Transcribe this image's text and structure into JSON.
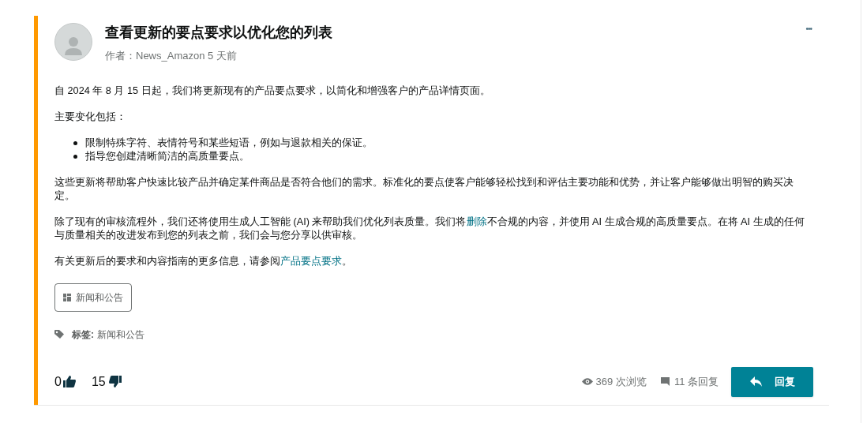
{
  "post": {
    "title": "查看更新的要点要求以优化您的列表",
    "byline": "作者：News_Amazon 5 天前",
    "menu": "•••",
    "paragraphs": [
      {
        "kind": "text",
        "segments": [
          {
            "text": "自 2024 年 8 月 15 日起，我们将更新现有的产品要点要求，以简化和增强客户的产品详情页面。",
            "kind": "plain"
          }
        ]
      },
      {
        "kind": "text",
        "segments": [
          {
            "text": "主要变化包括：",
            "kind": "plain"
          }
        ]
      },
      {
        "kind": "list",
        "items": [
          "限制特殊字符、表情符号和某些短语，例如与退款相关的保证。",
          "指导您创建清晰简洁的高质量要点。"
        ]
      },
      {
        "kind": "text",
        "segments": [
          {
            "text": "这些更新将帮助客户快速比较产品并确定某件商品是否符合他们的需求。标准化的要点使客户能够轻松找到和评估主要功能和优势，并让客户能够做出明智的购买决定。",
            "kind": "plain"
          }
        ]
      },
      {
        "kind": "text",
        "segments": [
          {
            "text": "除了现有的审核流程外，我们还将使用生成人工智能 (AI) 来帮助我们优化列表质量。我们将",
            "kind": "plain"
          },
          {
            "text": "删除",
            "kind": "link"
          },
          {
            "text": "不合规的内容，并使用 AI 生成合规的高质量要点。在将 AI 生成的任何与质量相关的改进发布到您的列表之前，我们会与您分享以供审核。",
            "kind": "plain"
          }
        ]
      },
      {
        "kind": "text",
        "segments": [
          {
            "text": "有关更新后的要求和内容指南的更多信息，请参阅",
            "kind": "plain"
          },
          {
            "text": "产品要点要求",
            "kind": "link"
          },
          {
            "text": "。",
            "kind": "plain"
          }
        ]
      }
    ],
    "board": "新闻和公告",
    "tags_label": "标签:",
    "tag": "新闻和公告",
    "likes": "0",
    "dislikes": "15",
    "views": "369 次浏览",
    "replies": "11 条回复",
    "reply_button": "回复"
  }
}
